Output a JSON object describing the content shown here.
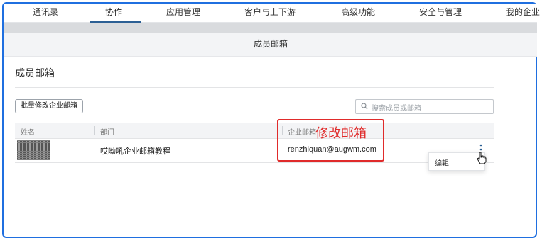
{
  "nav": {
    "tabs": [
      "通讯录",
      "协作",
      "应用管理",
      "客户与上下游",
      "高级功能",
      "安全与管理",
      "我的企业"
    ],
    "active_index": 1
  },
  "page_title": "成员邮箱",
  "section_title": "成员邮箱",
  "batch_button": "批量修改企业邮箱",
  "search": {
    "placeholder": "搜索成员或邮箱"
  },
  "table": {
    "headers": [
      "姓名",
      "部门",
      "企业邮箱"
    ],
    "rows": [
      {
        "department": "哎呦吼企业邮箱教程",
        "email": "renzhiquan@augwm.com"
      }
    ]
  },
  "annotation": "修改邮箱",
  "context_menu": {
    "items": [
      "编辑"
    ]
  },
  "colors": {
    "accent": "#2b5f94",
    "highlight": "#e02b2b",
    "frame": "#1f6fe0"
  }
}
